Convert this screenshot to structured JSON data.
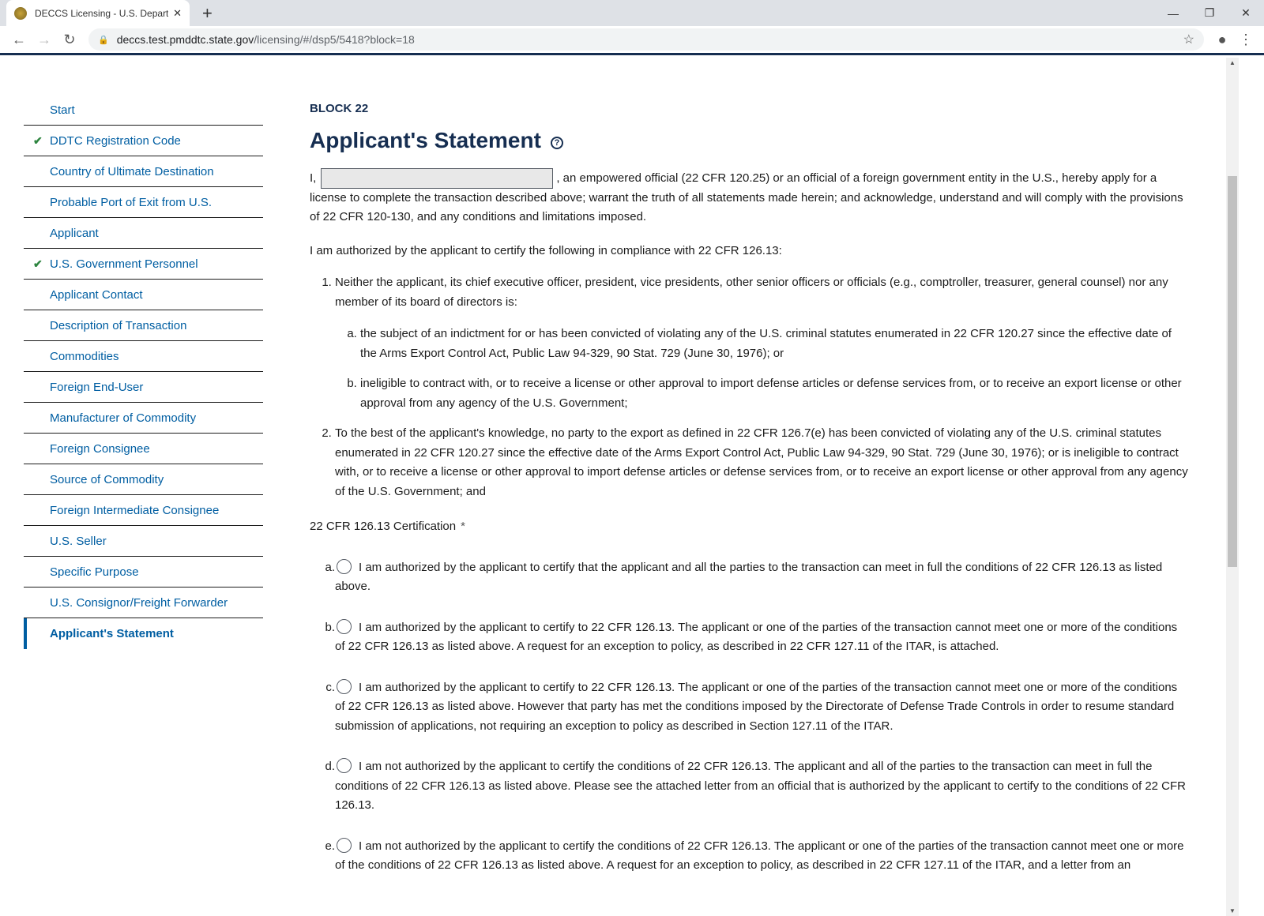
{
  "browser": {
    "tab_title": "DECCS Licensing - U.S. Departme",
    "url_host": "deccs.test.pmddtc.state.gov",
    "url_path": "/licensing/#/dsp5/5418?block=18"
  },
  "sidebar": {
    "items": [
      {
        "label": "Start",
        "done": false
      },
      {
        "label": "DDTC Registration Code",
        "done": true
      },
      {
        "label": "Country of Ultimate Destination",
        "done": false
      },
      {
        "label": "Probable Port of Exit from U.S.",
        "done": false
      },
      {
        "label": "Applicant",
        "done": false
      },
      {
        "label": "U.S. Government Personnel",
        "done": true
      },
      {
        "label": "Applicant Contact",
        "done": false
      },
      {
        "label": "Description of Transaction",
        "done": false
      },
      {
        "label": "Commodities",
        "done": false
      },
      {
        "label": "Foreign End-User",
        "done": false
      },
      {
        "label": "Manufacturer of Commodity",
        "done": false
      },
      {
        "label": "Foreign Consignee",
        "done": false
      },
      {
        "label": "Source of Commodity",
        "done": false
      },
      {
        "label": "Foreign Intermediate Consignee",
        "done": false
      },
      {
        "label": "U.S. Seller",
        "done": false
      },
      {
        "label": "Specific Purpose",
        "done": false
      },
      {
        "label": "U.S. Consignor/Freight Forwarder",
        "done": false
      },
      {
        "label": "Applicant's Statement",
        "done": false,
        "active": true
      }
    ]
  },
  "main": {
    "block": "BLOCK 22",
    "title": "Applicant's Statement",
    "intro_prefix": "I,",
    "name_value": "",
    "intro_suffix": ", an empowered official (22 CFR 120.25) or an official of a foreign government entity in the U.S., hereby apply for a license to complete the transaction described above; warrant the truth of all statements made herein; and acknowledge, understand and will comply with the provisions of 22 CFR 120-130, and any conditions and limitations imposed.",
    "authorized": "I am authorized by the applicant to certify the following in compliance with 22 CFR 126.13:",
    "item1": "Neither the applicant, its chief executive officer, president, vice presidents, other senior officers or officials (e.g., comptroller, treasurer, general counsel) nor any member of its board of directors is:",
    "item1a": "the subject of an indictment for or has been convicted of violating any of the U.S. criminal statutes enumerated in 22 CFR 120.27 since the effective date of the Arms Export Control Act, Public Law 94-329, 90 Stat. 729 (June 30, 1976); or",
    "item1b": "ineligible to contract with, or to receive a license or other approval to import defense articles or defense services from, or to receive an export license or other approval from any agency of the U.S. Government;",
    "item2": "To the best of the applicant's knowledge, no party to the export as defined in 22 CFR 126.7(e) has been convicted of violating any of the U.S. criminal statutes enumerated in 22 CFR 120.27 since the effective date of the Arms Export Control Act, Public Law 94-329, 90 Stat. 729 (June 30, 1976); or is ineligible to contract with, or to receive a license or other approval to import defense articles or defense services from, or to receive an export license or other approval from any agency of the U.S. Government; and",
    "cert_label": "22 CFR 126.13 Certification",
    "required_mark": "*",
    "options": [
      {
        "letter": "a.",
        "text": "I am authorized by the applicant to certify that the applicant and all the parties to the transaction can meet in full the conditions of 22 CFR 126.13 as listed above."
      },
      {
        "letter": "b.",
        "text": "I am authorized by the applicant to certify to 22 CFR 126.13. The applicant or one of the parties of the transaction cannot meet one or more of the conditions of 22 CFR 126.13 as listed above. A request for an exception to policy, as described in 22 CFR 127.11 of the ITAR, is attached."
      },
      {
        "letter": "c.",
        "text": "I am authorized by the applicant to certify to 22 CFR 126.13. The applicant or one of the parties of the transaction cannot meet one or more of the conditions of 22 CFR 126.13 as listed above. However that party has met the conditions imposed by the Directorate of Defense Trade Controls in order to resume standard submission of applications, not requiring an exception to policy as described in Section 127.11 of the ITAR."
      },
      {
        "letter": "d.",
        "text": "I am not authorized by the applicant to certify the conditions of 22 CFR 126.13. The applicant and all of the parties to the transaction can meet in full the conditions of 22 CFR 126.13 as listed above. Please see the attached letter from an official that is authorized by the applicant to certify to the conditions of 22 CFR 126.13."
      },
      {
        "letter": "e.",
        "text": "I am not authorized by the applicant to certify the conditions of 22 CFR 126.13. The applicant or one of the parties of the transaction cannot meet one or more of the conditions of 22 CFR 126.13 as listed above. A request for an exception to policy, as described in 22 CFR 127.11 of the ITAR, and a letter from an"
      }
    ]
  },
  "colors": {
    "link": "#005ea2",
    "heading": "#162e51",
    "check": "#2e8540"
  }
}
